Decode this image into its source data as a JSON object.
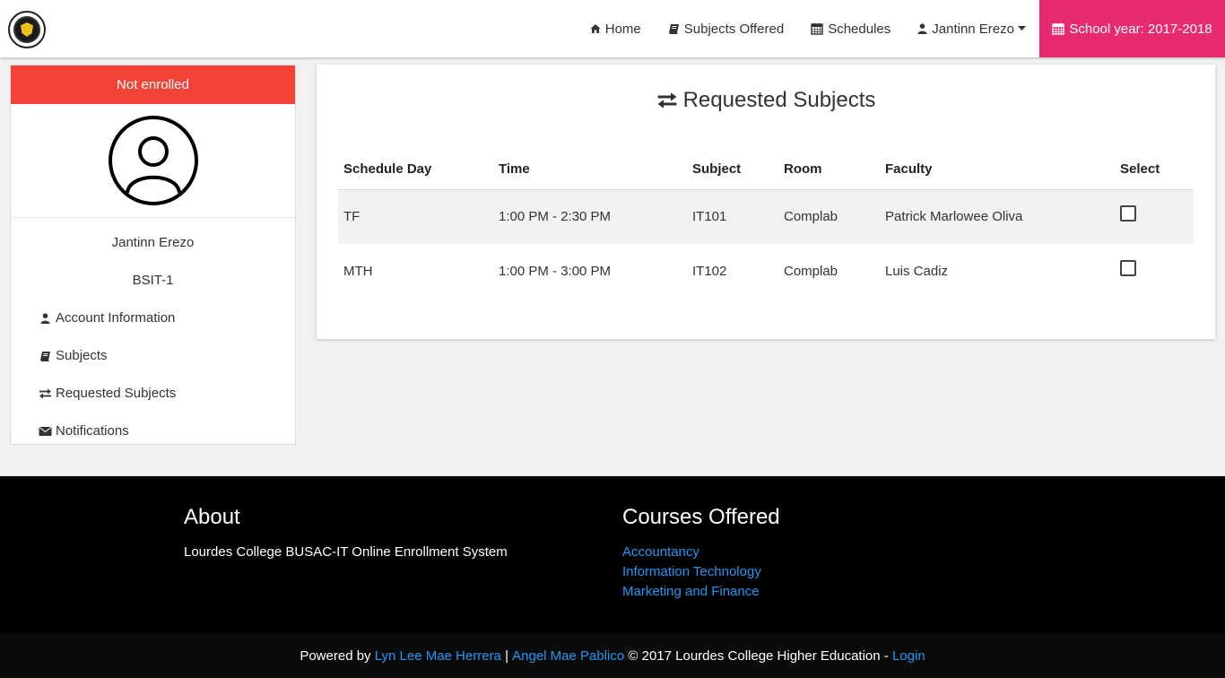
{
  "navbar": {
    "logo": "school-logo",
    "items": [
      {
        "label": "Home",
        "icon": "home-icon"
      },
      {
        "label": "Subjects Offered",
        "icon": "book-icon"
      },
      {
        "label": "Schedules",
        "icon": "calendar-icon"
      },
      {
        "label": "Jantinn Erezo",
        "icon": "user-icon"
      }
    ],
    "school_year": "School year: 2017-2018",
    "school_year_color": "#ea2a70"
  },
  "sidebar": {
    "status": "Not enrolled",
    "status_color": "#f44336",
    "name": "Jantinn Erezo",
    "course": "BSIT-1",
    "links": [
      {
        "label": "Account Information",
        "icon": "user-icon"
      },
      {
        "label": "Subjects",
        "icon": "book-icon"
      },
      {
        "label": "Requested Subjects",
        "icon": "exchange-icon"
      },
      {
        "label": "Notifications",
        "icon": "envelope-icon"
      }
    ]
  },
  "main": {
    "title": "Requested Subjects",
    "columns": [
      "Schedule Day",
      "Time",
      "Subject",
      "Room",
      "Faculty",
      "Select"
    ],
    "rows": [
      {
        "day": "TF",
        "time": "1:00 PM - 2:30 PM",
        "subject": "IT101",
        "room": "Complab",
        "faculty": "Patrick Marlowee Oliva",
        "selected": false
      },
      {
        "day": "MTH",
        "time": "1:00 PM - 3:00 PM",
        "subject": "IT102",
        "room": "Complab",
        "faculty": "Luis Cadiz",
        "selected": false
      }
    ]
  },
  "footer": {
    "about_title": "About",
    "about_text": "Lourdes College BUSAC-IT Online Enrollment System",
    "courses_title": "Courses Offered",
    "courses": [
      "Accountancy",
      "Information Technology",
      "Marketing and Finance"
    ],
    "copyright": {
      "powered_by": "Powered by ",
      "author1": "Lyn Lee Mae Herrera",
      "sep": " | ",
      "author2": "Angel Mae Pablico",
      "text": " © 2017 Lourdes College Higher Education - ",
      "login": "Login"
    },
    "link_color": "#2196f3"
  }
}
